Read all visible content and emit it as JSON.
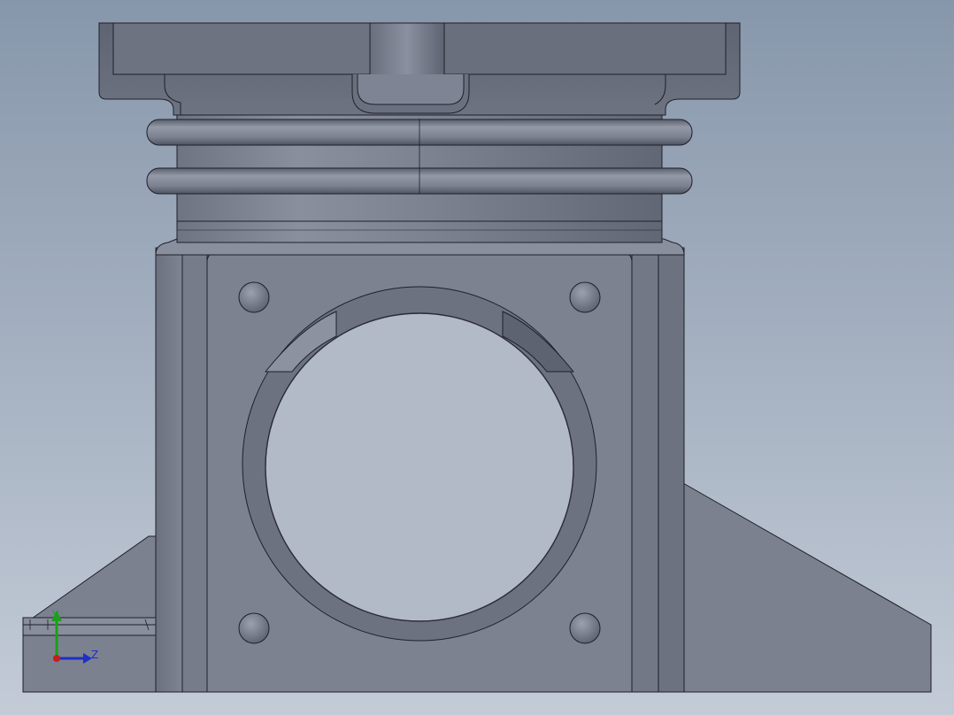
{
  "viewport": {
    "background_top": "#8797ab",
    "background_bottom": "#c3cbd7",
    "body_color": "#7c8190",
    "edge_color": "#1e2028"
  },
  "triad": {
    "y_label": "Y",
    "z_label": "Z",
    "y_color": "#1aa01a",
    "z_color": "#1d2fc8",
    "x_color": "#c81d1d"
  }
}
